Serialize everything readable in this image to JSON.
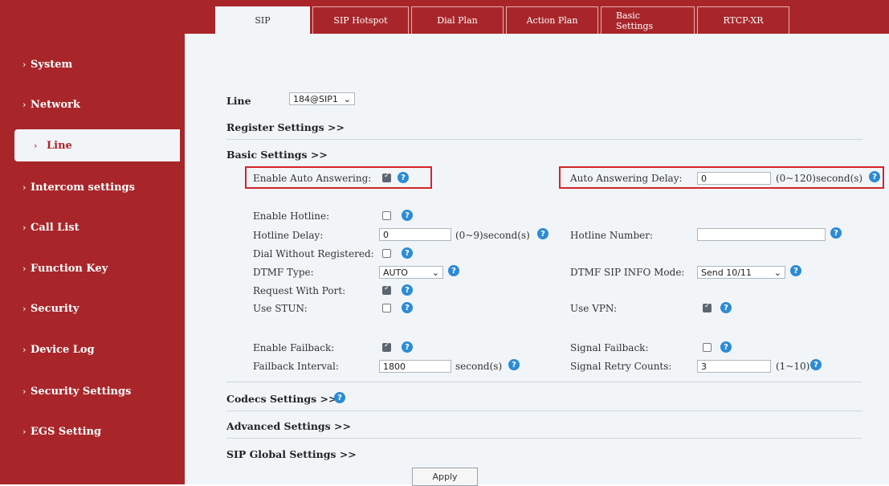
{
  "sidebar": {
    "items": [
      {
        "label": "System"
      },
      {
        "label": "Network"
      },
      {
        "label": "Line"
      },
      {
        "label": "Intercom settings"
      },
      {
        "label": "Call List"
      },
      {
        "label": "Function Key"
      },
      {
        "label": "Security"
      },
      {
        "label": "Device Log"
      },
      {
        "label": "Security Settings"
      },
      {
        "label": "EGS Setting"
      }
    ],
    "active": "Line"
  },
  "tabs": [
    "SIP",
    "SIP Hotspot",
    "Dial Plan",
    "Action Plan",
    "Basic Settings",
    "RTCP-XR"
  ],
  "line": {
    "label": "Line",
    "value": "184@SIP1"
  },
  "sections": {
    "register": "Register Settings >>",
    "basic": "Basic Settings >>",
    "codecs": "Codecs Settings >>",
    "advanced": "Advanced Settings >>",
    "global": "SIP Global Settings >>"
  },
  "fields": {
    "auto_answer": {
      "label": "Enable Auto Answering:",
      "checked": true
    },
    "auto_delay": {
      "label": "Auto Answering Delay:",
      "value": "0",
      "unit": "(0~120)second(s)"
    },
    "hotline": {
      "label": "Enable Hotline:",
      "checked": false
    },
    "hotline_delay": {
      "label": "Hotline Delay:",
      "value": "0",
      "unit": "(0~9)second(s)"
    },
    "hotline_number": {
      "label": "Hotline Number:",
      "value": ""
    },
    "dial_unreg": {
      "label": "Dial Without Registered:",
      "checked": false
    },
    "dtmf_type": {
      "label": "DTMF Type:",
      "value": "AUTO"
    },
    "dtmf_sip": {
      "label": "DTMF SIP INFO Mode:",
      "value": "Send 10/11"
    },
    "req_port": {
      "label": "Request With Port:",
      "checked": true
    },
    "stun": {
      "label": "Use STUN:",
      "checked": false
    },
    "vpn": {
      "label": "Use VPN:",
      "checked": true
    },
    "failback": {
      "label": "Enable Failback:",
      "checked": true
    },
    "signal_failback": {
      "label": "Signal Failback:",
      "checked": false
    },
    "failback_interval": {
      "label": "Failback Interval:",
      "value": "1800",
      "unit": "second(s)"
    },
    "retry_counts": {
      "label": "Signal Retry Counts:",
      "value": "3",
      "unit": "(1~10)"
    }
  },
  "apply_label": "Apply",
  "help_glyph": "?",
  "chevron": "›",
  "select_arrow": "⌄",
  "colors": {
    "brand": "#a8262a",
    "highlight_border": "#d4242b",
    "help": "#2d8bd3"
  }
}
